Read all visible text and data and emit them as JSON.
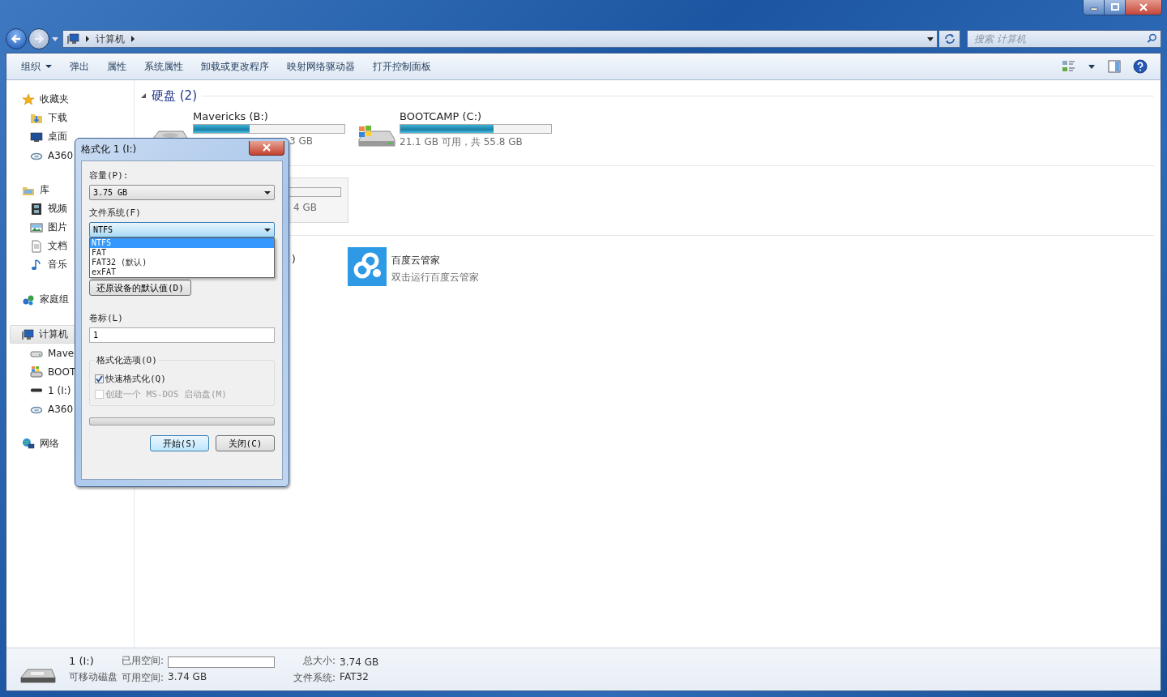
{
  "address": {
    "path": [
      "计算机"
    ]
  },
  "search": {
    "placeholder": "搜索 计算机"
  },
  "toolbar": [
    {
      "label": "组织",
      "kind": "menu"
    },
    {
      "label": "弹出",
      "kind": "plain"
    },
    {
      "label": "属性",
      "kind": "plain"
    },
    {
      "label": "系统属性",
      "kind": "plain"
    },
    {
      "label": "卸载或更改程序",
      "kind": "plain"
    },
    {
      "label": "映射网络驱动器",
      "kind": "plain"
    },
    {
      "label": "打开控制面板",
      "kind": "plain"
    }
  ],
  "sidebar": [
    {
      "label": "收藏夹",
      "kind": "star",
      "selected": false,
      "children": [
        {
          "label": "下载",
          "kind": "download",
          "selected": false
        },
        {
          "label": "桌面",
          "kind": "desktop",
          "selected": false
        },
        {
          "label": "A360",
          "kind": "cloud",
          "selected": false
        }
      ]
    },
    {
      "label": "库",
      "kind": "library",
      "selected": false,
      "children": [
        {
          "label": "视频",
          "kind": "video",
          "selected": false
        },
        {
          "label": "图片",
          "kind": "picture",
          "selected": false
        },
        {
          "label": "文档",
          "kind": "document",
          "selected": false
        },
        {
          "label": "音乐",
          "kind": "music",
          "selected": false
        }
      ]
    },
    {
      "label": "家庭组",
      "kind": "homegroup",
      "selected": false
    },
    {
      "label": "计算机",
      "kind": "computer",
      "selected": true,
      "children": [
        {
          "label": "Mave",
          "kind": "drive",
          "selected": false
        },
        {
          "label": "BOOT",
          "kind": "windows-drive",
          "selected": false
        },
        {
          "label": "1 (I:)",
          "kind": "usb",
          "selected": false
        },
        {
          "label": "A360",
          "kind": "cloud",
          "selected": false
        }
      ]
    },
    {
      "label": "网络",
      "kind": "network",
      "selected": false
    }
  ],
  "content": {
    "section_title": "硬盘 (2)",
    "drives": [
      {
        "name": "Mavericks (B:)",
        "kind": "drive",
        "level": 0.37,
        "info": "3 GB"
      },
      {
        "name": "BOOTCAMP (C:)",
        "kind": "windows-drive",
        "level": 0.62,
        "info": "21.1 GB 可用，共 55.8 GB"
      }
    ],
    "hidden_drive": {
      "info": "4 GB",
      "selected": true
    },
    "partial_text": ")",
    "app": {
      "name": "百度云管家",
      "description": "双击运行百度云管家"
    }
  },
  "dialog": {
    "title": "格式化 1 (I:)",
    "capacity": {
      "label": "容量(P):",
      "value": "3.75 GB"
    },
    "file_system": {
      "label": "文件系统(F)",
      "value": "NTFS",
      "options": [
        {
          "label": "NTFS",
          "selected": true
        },
        {
          "label": "FAT",
          "selected": false
        },
        {
          "label": "FAT32 (默认)",
          "selected": false
        },
        {
          "label": "exFAT",
          "selected": false
        }
      ]
    },
    "restore_button": "还原设备的默认值(D)",
    "volume": {
      "label": "卷标(L)",
      "value": "1"
    },
    "options_group": {
      "title": "格式化选项(O)",
      "checkboxes": [
        {
          "label": "快速格式化(Q)",
          "checked": true,
          "disabled": false
        },
        {
          "label": "创建一个 MS-DOS 启动盘(M)",
          "checked": false,
          "disabled": true
        }
      ]
    },
    "progress": {
      "level": 0
    },
    "buttons": [
      {
        "label": "开始(S)",
        "default": true
      },
      {
        "label": "关闭(C)",
        "default": false
      }
    ]
  },
  "details": {
    "name": "1 (I:)",
    "type": "可移动磁盘",
    "used_label": "已用空间:",
    "used": {
      "level": 0
    },
    "free_label": "可用空间:",
    "free_value": "3.74 GB",
    "total_label": "总大小:",
    "total_value": "3.74 GB",
    "fs_label": "文件系统:",
    "fs_value": "FAT32"
  }
}
